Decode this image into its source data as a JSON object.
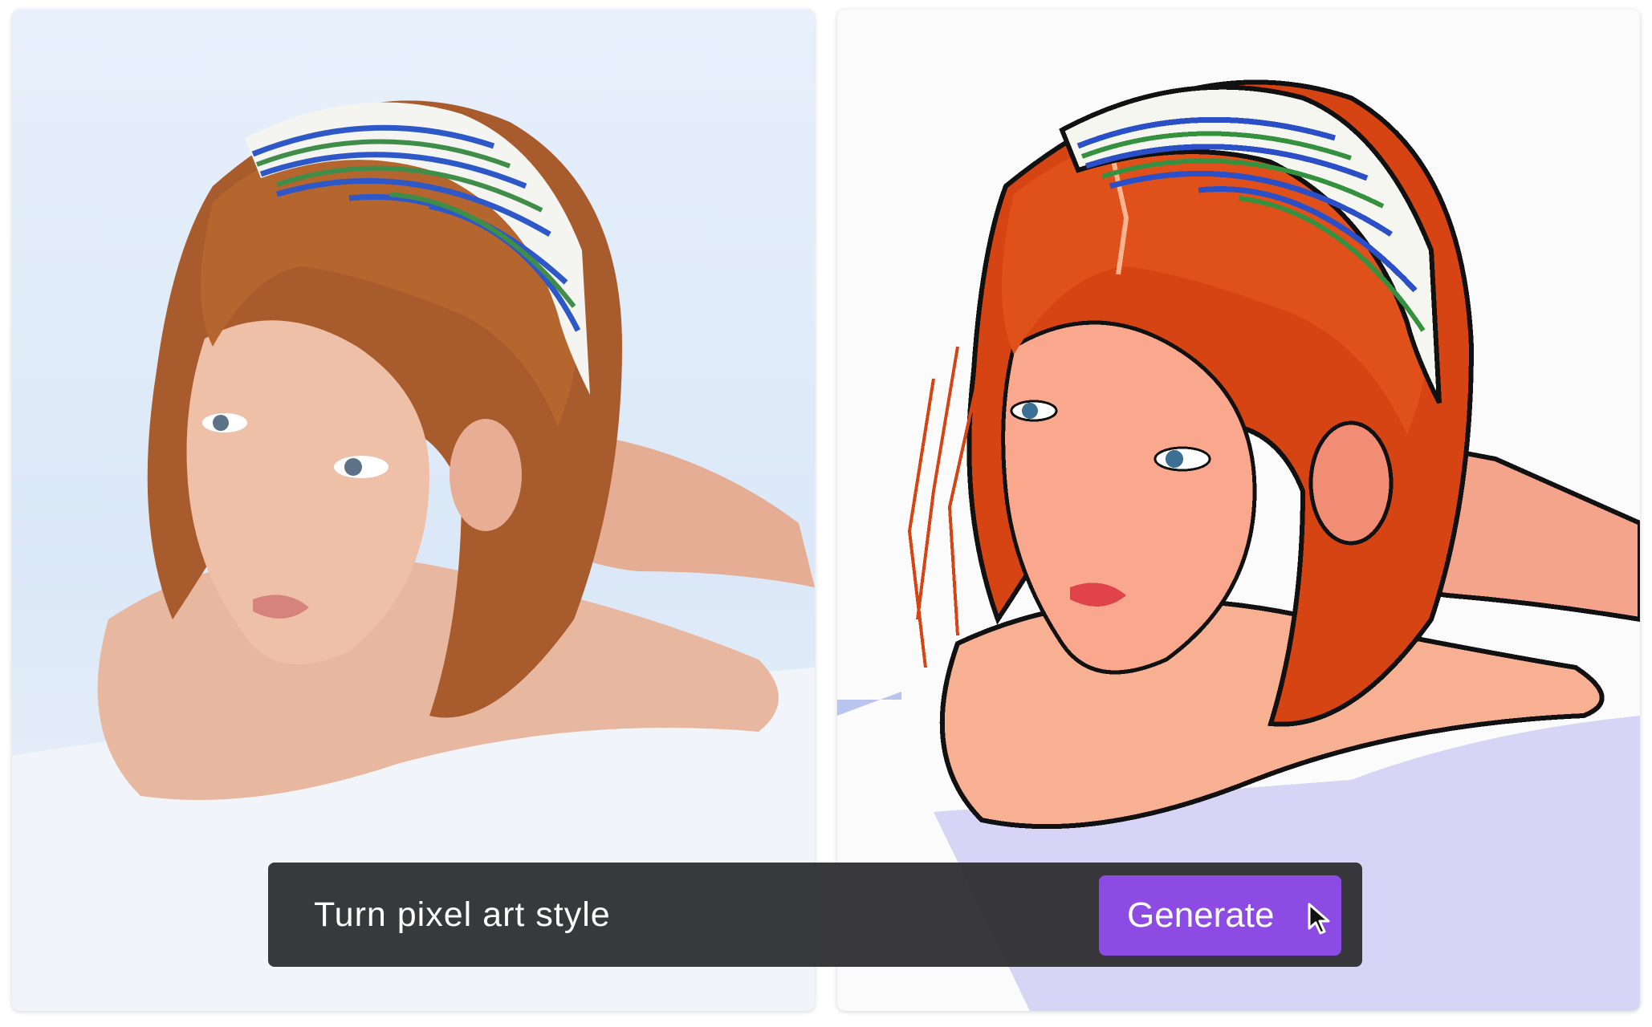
{
  "prompt_bar": {
    "prompt_text": "Turn pixel art style",
    "generate_label": "Generate"
  },
  "images": {
    "original": {
      "kind": "photo",
      "subject": "portrait"
    },
    "result": {
      "kind": "pixel-art",
      "subject": "portrait"
    }
  },
  "icons": {
    "cursor": "mouse-pointer-icon"
  },
  "colors": {
    "bar_background": "#28282a",
    "button_accent": "#8c4be2",
    "text": "#ffffff"
  }
}
